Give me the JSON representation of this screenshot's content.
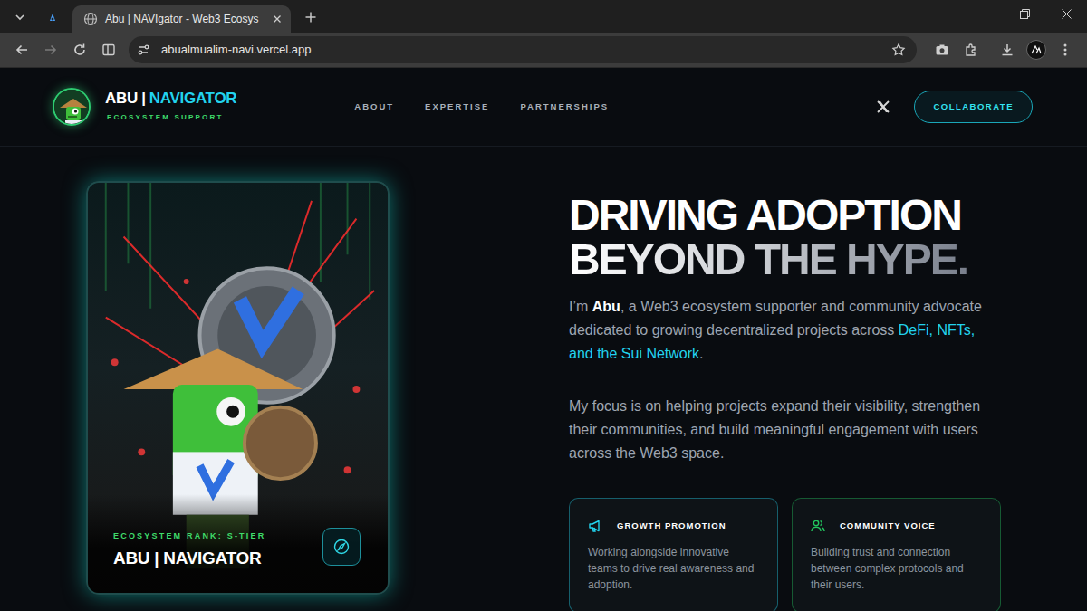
{
  "browser": {
    "tabs": [
      {
        "label": "Abu | NAVIgator - Web3 Ecosys",
        "selected": true
      }
    ],
    "address": "abualmualim-navi.vercel.app"
  },
  "site": {
    "brand": {
      "name": "ABU |",
      "accent": "NAVIGATOR",
      "tagline": "ECOSYSTEM SUPPORT"
    },
    "nav": [
      {
        "label": "ABOUT"
      },
      {
        "label": "EXPERTISE"
      },
      {
        "label": "PARTNERSHIPS"
      }
    ],
    "cta": "COLLABORATE"
  },
  "hero": {
    "card": {
      "rank": "ECOSYSTEM RANK: S-TIER",
      "title": "ABU | NAVIGATOR"
    },
    "headline": [
      "DRIVING ADOPTION",
      "BEYOND THE HYPE."
    ],
    "intro": {
      "before": "I’m ",
      "name": "Abu",
      "middle": ", a Web3 ecosystem supporter and community advocate dedicated to growing decentralized projects across ",
      "highlight": "DeFi, NFTs, and the Sui Network",
      "after": "."
    },
    "focus": "My focus is on helping projects expand their visibility, strengthen their communities, and build meaningful engagement with users across the Web3 space.",
    "features": [
      {
        "title": "GROWTH PROMOTION",
        "text": "Working alongside innovative teams to drive real awareness and adoption.",
        "color": "#22d3ee"
      },
      {
        "title": "COMMUNITY VOICE",
        "text": "Building trust and connection between complex protocols and their users.",
        "color": "#22c55e"
      }
    ]
  }
}
